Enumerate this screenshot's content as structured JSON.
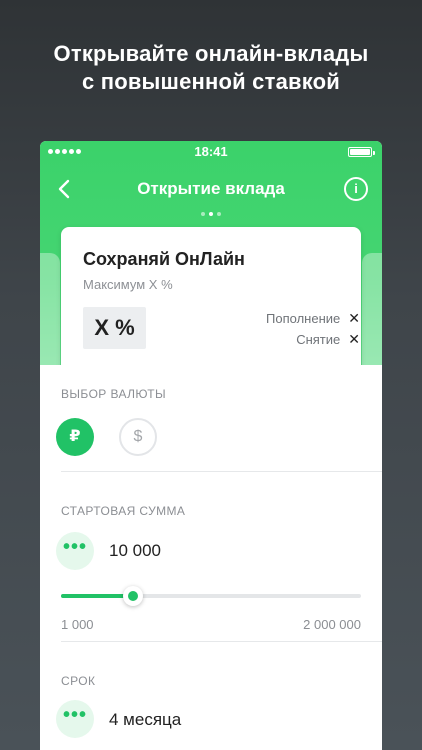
{
  "promo": {
    "line1": "Открывайте онлайн-вклады",
    "line2": "с повышенной ставкой"
  },
  "status_bar": {
    "time": "18:41"
  },
  "nav": {
    "title": "Открытие вклада",
    "back_icon": "chevron-left-icon",
    "info_label": "i",
    "page_count": 3,
    "active_page": 1
  },
  "deposit_card": {
    "title": "Сохраняй ОнЛайн",
    "subtitle": "Максимум X %",
    "rate": "X %",
    "features": [
      {
        "label": "Пополнение",
        "mark": "✕"
      },
      {
        "label": "Снятие",
        "mark": "✕"
      }
    ]
  },
  "currency": {
    "label": "ВЫБОР ВАЛЮТЫ",
    "options": [
      {
        "symbol": "₽",
        "selected": true
      },
      {
        "symbol": "$",
        "selected": false
      }
    ]
  },
  "start_amount": {
    "label": "СТАРТОВАЯ СУММА",
    "value": "10 000",
    "min_label": "1 000",
    "max_label": "2 000 000",
    "slider_fraction": 0.24
  },
  "term": {
    "label": "СРОК",
    "value": "4 месяца"
  },
  "more_label": "•••",
  "colors": {
    "accent": "#21c266",
    "header_green": "#45d572"
  }
}
